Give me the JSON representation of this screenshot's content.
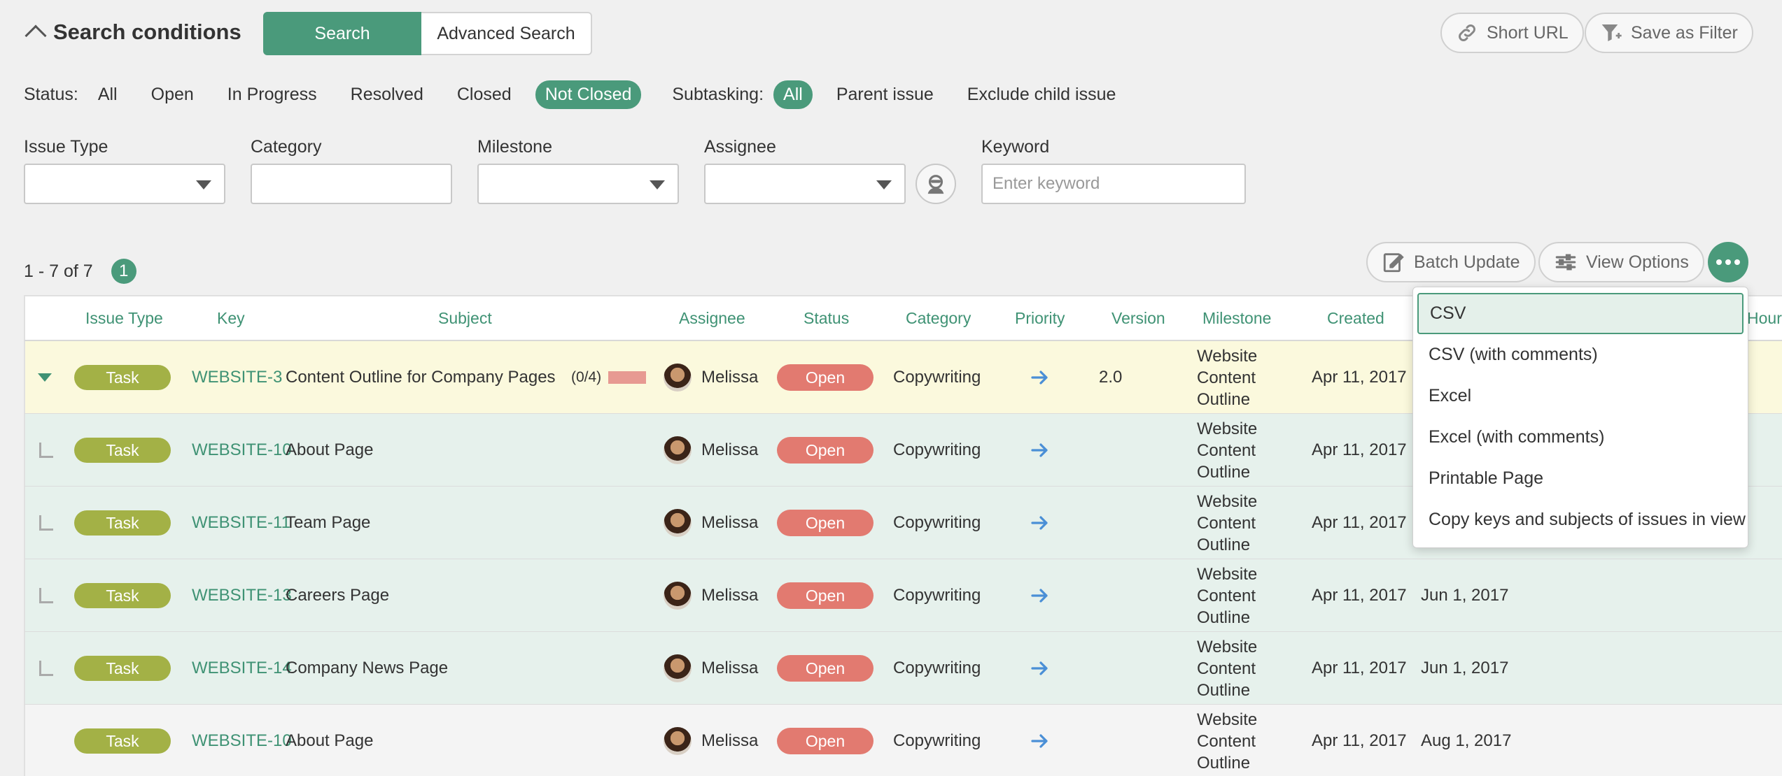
{
  "header": {
    "title": "Search conditions",
    "search_tab": "Search",
    "advanced_tab": "Advanced Search",
    "short_url": "Short URL",
    "save_filter": "Save as Filter"
  },
  "filters": {
    "status_label": "Status:",
    "status_options": [
      "All",
      "Open",
      "In Progress",
      "Resolved",
      "Closed",
      "Not Closed"
    ],
    "status_selected": "Not Closed",
    "subtasking_label": "Subtasking:",
    "subtasking_options": [
      "All",
      "Parent issue",
      "Exclude child issue"
    ],
    "subtasking_selected": "All",
    "issue_type_label": "Issue Type",
    "category_label": "Category",
    "milestone_label": "Milestone",
    "assignee_label": "Assignee",
    "keyword_label": "Keyword",
    "keyword_placeholder": "Enter keyword"
  },
  "results": {
    "count_text": "1 - 7 of 7",
    "page": "1",
    "batch_update": "Batch Update",
    "view_options": "View Options"
  },
  "table": {
    "columns": [
      "Issue Type",
      "Key",
      "Subject",
      "Assignee",
      "Status",
      "Category",
      "Priority",
      "Version",
      "Milestone",
      "Created",
      "Hours"
    ],
    "rows": [
      {
        "kind": "parent",
        "type": "Task",
        "key": "WEBSITE-3",
        "subject": "Content Outline for Company Pages",
        "subtasks": "(0/4)",
        "assignee": "Melissa",
        "status": "Open",
        "category": "Copywriting",
        "version": "2.0",
        "milestone": [
          "Website",
          "Content",
          "Outline"
        ],
        "created": "Apr 11, 2017",
        "due": ""
      },
      {
        "kind": "child",
        "type": "Task",
        "key": "WEBSITE-10",
        "subject": "About Page",
        "assignee": "Melissa",
        "status": "Open",
        "category": "Copywriting",
        "version": "",
        "milestone": [
          "Website",
          "Content",
          "Outline"
        ],
        "created": "Apr 11, 2017",
        "due": ""
      },
      {
        "kind": "child",
        "type": "Task",
        "key": "WEBSITE-11",
        "subject": "Team Page",
        "assignee": "Melissa",
        "status": "Open",
        "category": "Copywriting",
        "version": "",
        "milestone": [
          "Website",
          "Content",
          "Outline"
        ],
        "created": "Apr 11, 2017",
        "due": ""
      },
      {
        "kind": "child",
        "type": "Task",
        "key": "WEBSITE-13",
        "subject": "Careers Page",
        "assignee": "Melissa",
        "status": "Open",
        "category": "Copywriting",
        "version": "",
        "milestone": [
          "Website",
          "Content",
          "Outline"
        ],
        "created": "Apr 11, 2017",
        "due": "Jun 1, 2017"
      },
      {
        "kind": "child",
        "type": "Task",
        "key": "WEBSITE-14",
        "subject": "Company News Page",
        "assignee": "Melissa",
        "status": "Open",
        "category": "Copywriting",
        "version": "",
        "milestone": [
          "Website",
          "Content",
          "Outline"
        ],
        "created": "Apr 11, 2017",
        "due": "Jun 1, 2017"
      },
      {
        "kind": "plain",
        "type": "Task",
        "key": "WEBSITE-10",
        "subject": "About Page",
        "assignee": "Melissa",
        "status": "Open",
        "category": "Copywriting",
        "version": "",
        "milestone": [
          "Website",
          "Content",
          "Outline"
        ],
        "created": "Apr 11, 2017",
        "due": "Aug 1, 2017"
      }
    ]
  },
  "export_menu": {
    "items": [
      "CSV",
      "CSV (with comments)",
      "Excel",
      "Excel (with comments)",
      "Printable Page",
      "Copy keys and subjects of issues in view"
    ],
    "highlighted": "CSV"
  },
  "icons": {
    "collapse": "chevron-up-icon",
    "short_url": "link-icon",
    "save_filter": "funnel-plus-icon",
    "batch_update": "edit-icon",
    "view_options": "sliders-icon",
    "more": "ellipsis-icon",
    "me": "person-icon",
    "priority": "arrow-right-icon"
  },
  "colors": {
    "accent": "#4a9a7b",
    "task_tag": "#a3b146",
    "status_open": "#e27a70",
    "parent_row": "#fbf9dd",
    "child_row": "#e6f1ec",
    "priority_arrow": "#4a8fd6"
  }
}
